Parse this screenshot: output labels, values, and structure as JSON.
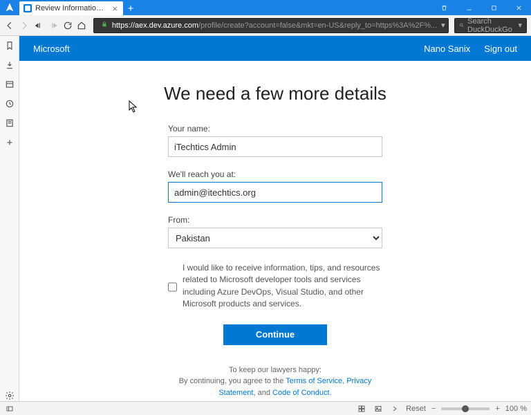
{
  "tab": {
    "title": "Review Information | Micros"
  },
  "url": {
    "domain": "https://aex.dev.azure.com",
    "path": "/profile/create?account=false&mkt=en-US&reply_to=https%3A%2F%..."
  },
  "search": {
    "placeholder": "Search DuckDuckGo"
  },
  "msheader": {
    "brand": "Microsoft",
    "user": "Nano Sanix",
    "signout": "Sign out"
  },
  "form": {
    "title": "We need a few more details",
    "name_label": "Your name:",
    "name_value": "iTechtics Admin",
    "email_label": "We'll reach you at:",
    "email_value": "admin@itechtics.org",
    "from_label": "From:",
    "from_value": "Pakistan",
    "consent": "I would like to receive information, tips, and resources related to Microsoft developer tools and services including Azure DevOps, Visual Studio, and other Microsoft products and services.",
    "continue": "Continue"
  },
  "legal": {
    "line1": "To keep our lawyers happy:",
    "prefix": "By continuing, you agree to the ",
    "tos": "Terms of Service",
    "sep1": ", ",
    "privacy": "Privacy Statement",
    "sep2": ", and ",
    "coc": "Code of Conduct",
    "end": "."
  },
  "status": {
    "reset": "Reset",
    "zoom": "100 %"
  }
}
